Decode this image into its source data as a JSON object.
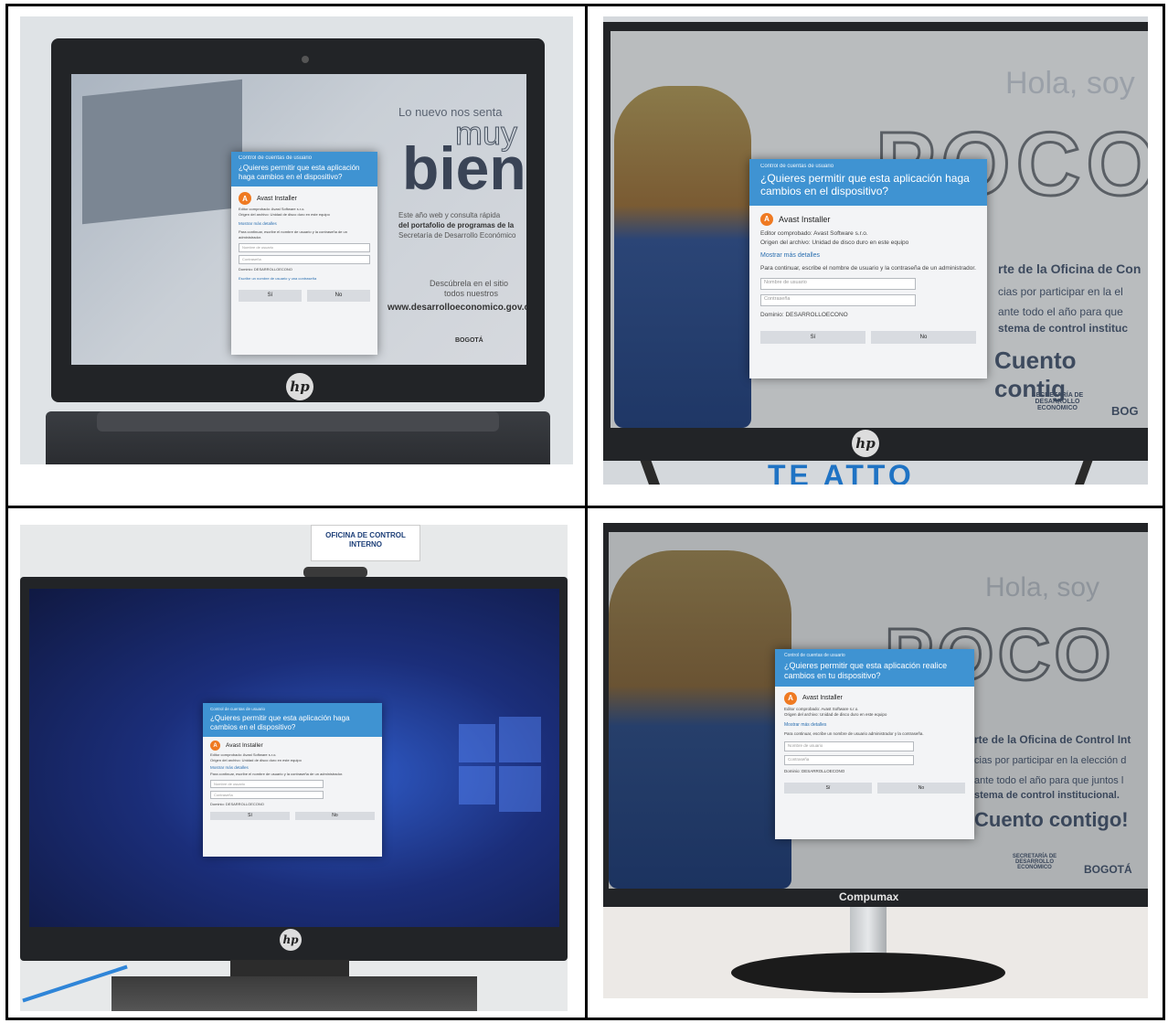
{
  "dialog_common": {
    "caption": "Control de cuentas de usuario",
    "question": "¿Quieres permitir que esta aplicación haga cambios en el dispositivo?",
    "question_alt": "¿Quieres permitir que esta aplicación realice cambios en tu dispositivo?",
    "app_name": "Avast Installer",
    "publisher": "Editor comprobado: Avast Software s.r.o.",
    "origin": "Origen del archivo: Unidad de disco duro en este equipo",
    "more_details": "Mostrar más detalles",
    "instruction": "Para continuar, escribe el nombre de usuario y la contraseña de un administrador.",
    "instruction_alt": "Para continuar, escribe un nombre de usuario administrador y la contraseña.",
    "username_placeholder": "Nombre de usuario",
    "password_placeholder": "Contraseña",
    "domain": "Dominio: DESARROLLOECONO",
    "alt_login": "Escribe un nombre de usuario y una contraseña",
    "yes": "Sí",
    "no": "No"
  },
  "panel1": {
    "headline_small": "Lo nuevo nos senta",
    "headline_muy": "muy",
    "headline_bien": "bien",
    "body1": "Este año web y consulta rápida",
    "body2": "del portafolio de programas de la",
    "body3": "Secretaría de Desarrollo Económico",
    "discover": "Descúbrela en el sitio",
    "discover2": "todos nuestros",
    "url": "www.desarrolloeconomico.gov.co",
    "brand": "BOGOTÁ",
    "hp": "hp"
  },
  "panel2": {
    "hola": "Hola, soy",
    "poco": "POCO",
    "line1": "rte de la Oficina de Con",
    "line2": "cias por participar en la el",
    "line3": "ante todo el año para que",
    "line4": "stema de control instituc",
    "cuento": "Cuento contig",
    "sec_label": "SECRETARÍA DE DESARROLLO ECONÓMICO",
    "bogota": "BOG",
    "hp": "hp",
    "bottom_text": "TE ATTO"
  },
  "panel3": {
    "sign": "OFICINA DE CONTROL INTERNO",
    "hp": "hp"
  },
  "panel4": {
    "hola": "Hola, soy",
    "poco": "POCO",
    "line1": "rte de la Oficina de Control Int",
    "line2": "cias por participar en la elección d",
    "line3": "ante todo el año para que juntos l",
    "line4": "stema de control institucional.",
    "cuento": "Cuento contigo!",
    "sec_label": "SECRETARÍA DE DESARROLLO ECONÓMICO",
    "bogota": "BOGOTÁ",
    "brand": "Compumax"
  }
}
